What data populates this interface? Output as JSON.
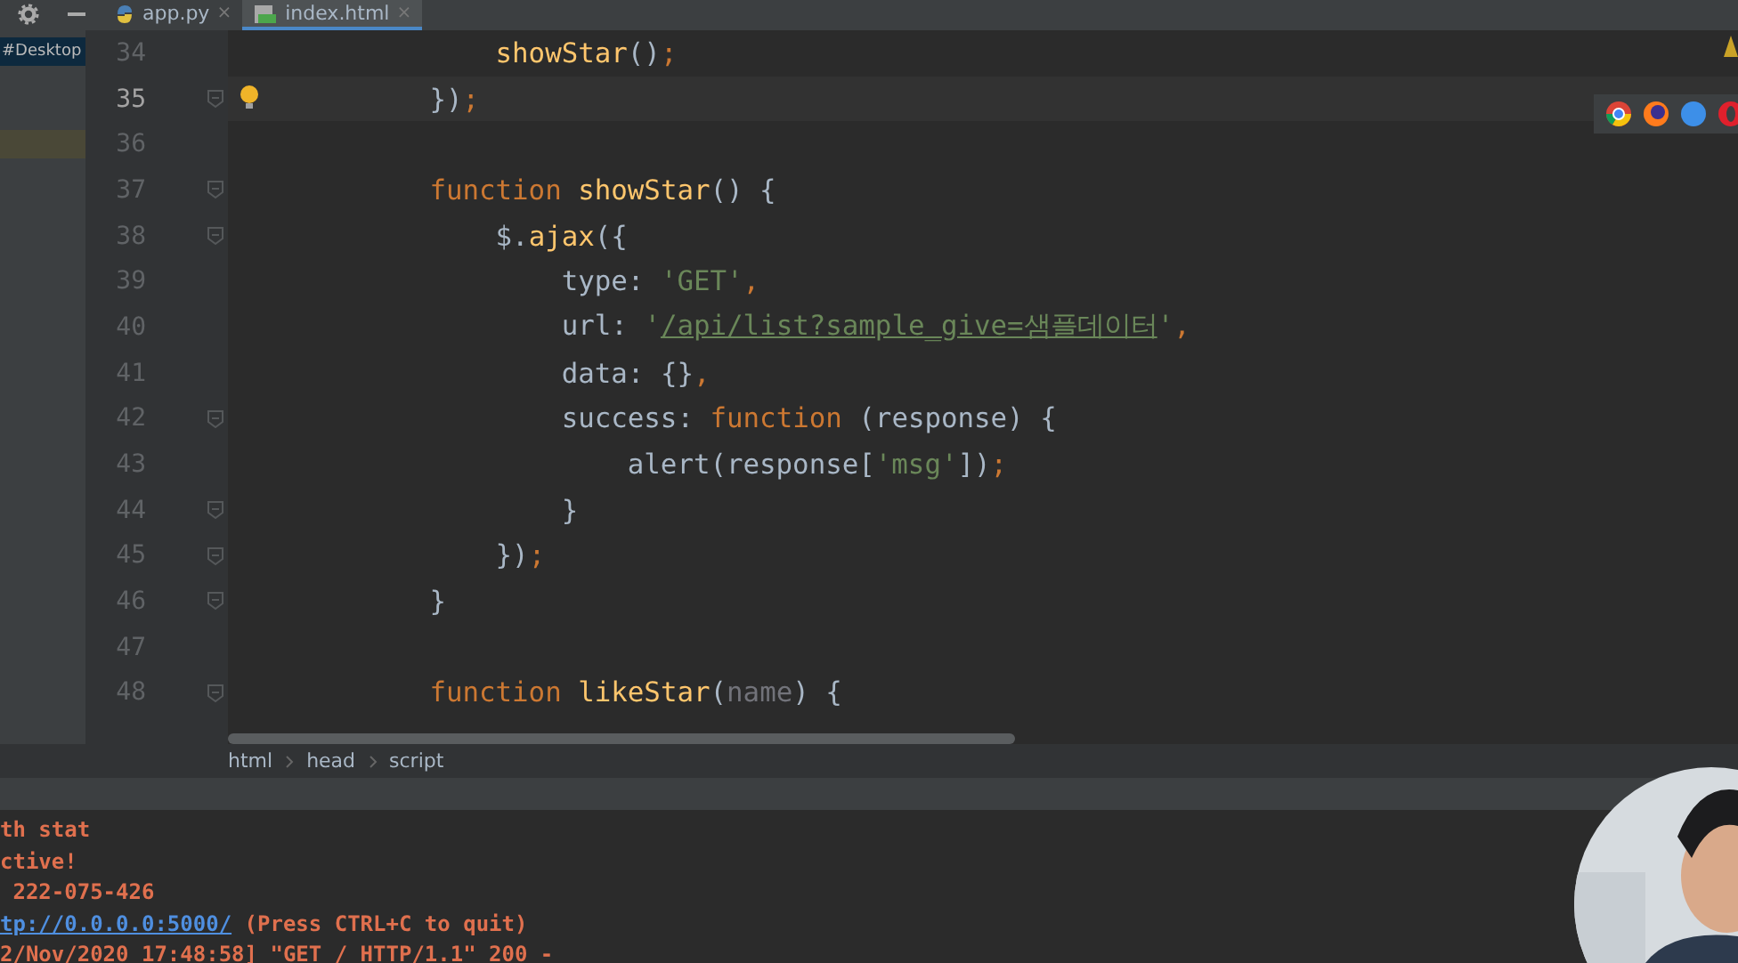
{
  "project_pane": {
    "path": "#Desktop"
  },
  "tabs": [
    {
      "label": "app.py",
      "kind": "python",
      "selected": false,
      "close": "×"
    },
    {
      "label": "index.html",
      "kind": "html",
      "selected": true,
      "close": "×"
    }
  ],
  "editor": {
    "lines": [
      {
        "number": "34",
        "current": false,
        "fold": false,
        "tokens": [
          {
            "kind": "func",
            "text": "                showStar"
          },
          {
            "kind": "plain",
            "text": "()"
          },
          {
            "kind": "punct",
            "text": ";"
          }
        ]
      },
      {
        "number": "35",
        "current": true,
        "fold": true,
        "tokens": [
          {
            "kind": "plain",
            "text": "            })"
          },
          {
            "kind": "punct",
            "text": ";"
          }
        ]
      },
      {
        "number": "36",
        "current": false,
        "fold": false
      },
      {
        "number": "37",
        "current": false,
        "fold": true,
        "tokens": [
          {
            "kind": "keyword",
            "text": "            function "
          },
          {
            "kind": "func",
            "text": "showStar"
          },
          {
            "kind": "plain",
            "text": "() {"
          }
        ]
      },
      {
        "number": "38",
        "current": false,
        "fold": true,
        "tokens": [
          {
            "kind": "plain",
            "text": "                $."
          },
          {
            "kind": "func",
            "text": "ajax"
          },
          {
            "kind": "plain",
            "text": "({"
          }
        ]
      },
      {
        "number": "39",
        "current": false,
        "fold": false,
        "tokens": [
          {
            "kind": "prop",
            "text": "                    type"
          },
          {
            "kind": "plain",
            "text": ": "
          },
          {
            "kind": "string",
            "text": "'GET'"
          },
          {
            "kind": "punct",
            "text": ","
          }
        ]
      },
      {
        "number": "40",
        "current": false,
        "fold": false,
        "tokens": [
          {
            "kind": "prop",
            "text": "                    url"
          },
          {
            "kind": "plain",
            "text": ": "
          },
          {
            "kind": "string",
            "text": "'"
          },
          {
            "kind": "url",
            "text": "/api/list?sample_give=샘플데이터"
          },
          {
            "kind": "string",
            "text": "'"
          },
          {
            "kind": "punct",
            "text": ","
          }
        ]
      },
      {
        "number": "41",
        "current": false,
        "fold": false,
        "tokens": [
          {
            "kind": "prop",
            "text": "                    data"
          },
          {
            "kind": "plain",
            "text": ": {}"
          },
          {
            "kind": "punct",
            "text": ","
          }
        ]
      },
      {
        "number": "42",
        "current": false,
        "fold": true,
        "tokens": [
          {
            "kind": "prop",
            "text": "                    success"
          },
          {
            "kind": "plain",
            "text": ": "
          },
          {
            "kind": "keyword",
            "text": "function "
          },
          {
            "kind": "plain",
            "text": "(response) {"
          }
        ]
      },
      {
        "number": "43",
        "current": false,
        "fold": false,
        "tokens": [
          {
            "kind": "plain",
            "text": "                        alert(response["
          },
          {
            "kind": "string",
            "text": "'msg'"
          },
          {
            "kind": "plain",
            "text": "])"
          },
          {
            "kind": "punct",
            "text": ";"
          }
        ]
      },
      {
        "number": "44",
        "current": false,
        "fold": true,
        "tokens": [
          {
            "kind": "plain",
            "text": "                    }"
          }
        ]
      },
      {
        "number": "45",
        "current": false,
        "fold": true,
        "tokens": [
          {
            "kind": "plain",
            "text": "                })"
          },
          {
            "kind": "punct",
            "text": ";"
          }
        ]
      },
      {
        "number": "46",
        "current": false,
        "fold": true,
        "tokens": [
          {
            "kind": "plain",
            "text": "            }"
          }
        ]
      },
      {
        "number": "47",
        "current": false,
        "fold": false
      },
      {
        "number": "48",
        "current": false,
        "fold": true,
        "tokens": [
          {
            "kind": "keyword",
            "text": "            function "
          },
          {
            "kind": "func",
            "text": "likeStar"
          },
          {
            "kind": "plain",
            "text": "("
          },
          {
            "kind": "unused",
            "text": "name"
          },
          {
            "kind": "plain",
            "text": ") {"
          }
        ]
      }
    ]
  },
  "breadcrumbs": [
    "html",
    "head",
    "script"
  ],
  "terminal": {
    "lines": [
      {
        "parts": [
          {
            "kind": "text",
            "text": "th stat"
          }
        ]
      },
      {
        "parts": [
          {
            "kind": "text",
            "text": "ctive!"
          }
        ]
      },
      {
        "parts": [
          {
            "kind": "text",
            "text": " 222-075-426"
          }
        ]
      },
      {
        "parts": [
          {
            "kind": "link",
            "text": "tp://0.0.0.0:5000/"
          },
          {
            "kind": "text",
            "text": " (Press CTRL+C to quit)"
          }
        ]
      },
      {
        "parts": [
          {
            "kind": "text",
            "text": "2/Nov/2020 17:48:58] \"GET / HTTP/1.1\" 200 -"
          }
        ]
      }
    ]
  },
  "browsers": [
    {
      "kind": "chrome"
    },
    {
      "kind": "firefox"
    },
    {
      "kind": "safari"
    },
    {
      "kind": "opera"
    }
  ],
  "webcam": {
    "kind": "picture"
  }
}
